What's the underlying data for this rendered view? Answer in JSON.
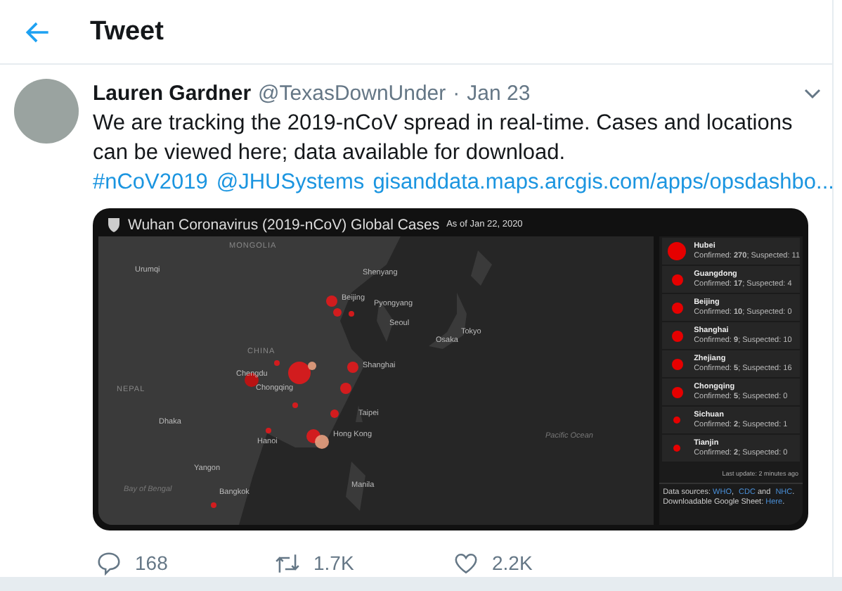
{
  "header": {
    "title": "Tweet"
  },
  "tweet": {
    "name": "Lauren Gardner",
    "handle": "@TexasDownUnder",
    "separator": "·",
    "date": "Jan 23",
    "body": [
      {
        "kind": "text",
        "text": "We are tracking the 2019-nCoV spread in real-time. Cases and locations can be viewed here; data available for download. "
      },
      {
        "kind": "link",
        "text": "#nCoV2019"
      },
      {
        "kind": "link",
        "text": "@JHUSystems"
      },
      {
        "kind": "link",
        "text": "gisanddata.maps.arcgis.com/apps/opsdashbo..."
      }
    ]
  },
  "dashboard": {
    "title": "Wuhan Coronavirus (2019-nCoV) Global Cases",
    "as_of": "As of Jan 22, 2020",
    "map_labels": [
      {
        "text": "MONGOLIA",
        "kind": "country"
      },
      {
        "text": "Urumqi",
        "kind": "city"
      },
      {
        "text": "Beijing",
        "kind": "city"
      },
      {
        "text": "Shenyang",
        "kind": "city"
      },
      {
        "text": "Pyongyang",
        "kind": "city"
      },
      {
        "text": "Seoul",
        "kind": "city"
      },
      {
        "text": "Osaka",
        "kind": "city"
      },
      {
        "text": "Tokyo",
        "kind": "city"
      },
      {
        "text": "CHINA",
        "kind": "country"
      },
      {
        "text": "Chengdu",
        "kind": "city"
      },
      {
        "text": "Chongqing",
        "kind": "city"
      },
      {
        "text": "Shanghai",
        "kind": "city"
      },
      {
        "text": "NEPAL",
        "kind": "country"
      },
      {
        "text": "Dhaka",
        "kind": "city"
      },
      {
        "text": "Taipei",
        "kind": "city"
      },
      {
        "text": "Hong Kong",
        "kind": "city"
      },
      {
        "text": "Hanoi",
        "kind": "city"
      },
      {
        "text": "Pacific Ocean",
        "kind": "water"
      },
      {
        "text": "Yangon",
        "kind": "city"
      },
      {
        "text": "Manila",
        "kind": "city"
      },
      {
        "text": "Bay of Bengal",
        "kind": "water"
      },
      {
        "text": "Bangkok",
        "kind": "city"
      }
    ],
    "cases": [
      {
        "region": "Hubei",
        "stats": "Confirmed: **270**; Suspected: 11",
        "kind": "large"
      },
      {
        "region": "Guangdong",
        "stats": "Confirmed: **17**; Suspected: 4",
        "kind": "medium"
      },
      {
        "region": "Beijing",
        "stats": "Confirmed: **10**; Suspected: 0",
        "kind": "medium"
      },
      {
        "region": "Shanghai",
        "stats": "Confirmed: **9**; Suspected: 10",
        "kind": "medium"
      },
      {
        "region": "Zhejiang",
        "stats": "Confirmed: **5**; Suspected: 16",
        "kind": "medium"
      },
      {
        "region": "Chongqing",
        "stats": "Confirmed: **5**; Suspected: 0",
        "kind": "medium"
      },
      {
        "region": "Sichuan",
        "stats": "Confirmed: **2**; Suspected: 1",
        "kind": "small"
      },
      {
        "region": "Tianjin",
        "stats": "Confirmed: **2**; Suspected: 0",
        "kind": "small"
      }
    ],
    "last_update": "Last update: 2 minutes ago",
    "sources": [
      [
        {
          "kind": "text",
          "text": "Data sources: "
        },
        {
          "kind": "link",
          "text": "WHO"
        },
        {
          "kind": "text",
          "text": ", "
        },
        {
          "kind": "link",
          "text": "CDC"
        },
        {
          "kind": "text",
          "text": " and "
        },
        {
          "kind": "link",
          "text": "NHC"
        },
        {
          "kind": "text",
          "text": "."
        }
      ],
      [
        {
          "kind": "text",
          "text": "Downloadable Google Sheet: "
        },
        {
          "kind": "link",
          "text": "Here"
        },
        {
          "kind": "text",
          "text": "."
        }
      ]
    ]
  },
  "actions": [
    {
      "kind": "reply",
      "count": "168"
    },
    {
      "kind": "retweet",
      "count": "1.7K"
    },
    {
      "kind": "like",
      "count": "2.2K"
    }
  ]
}
